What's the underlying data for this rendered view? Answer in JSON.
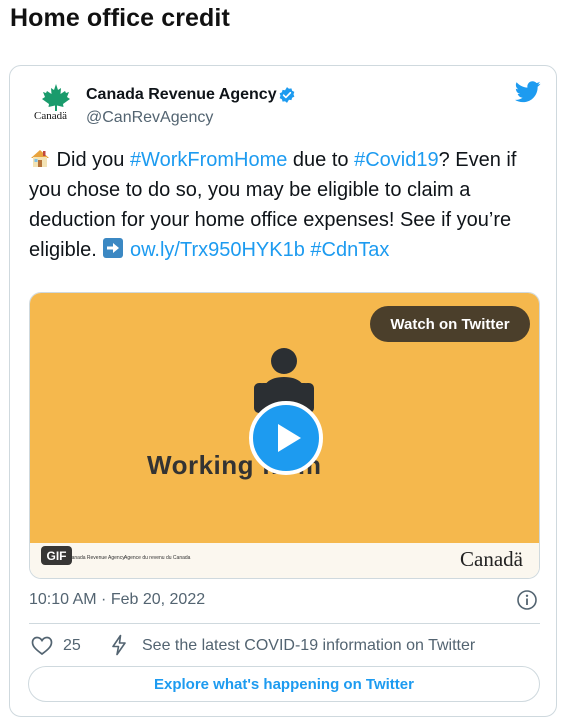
{
  "page": {
    "title": "Home office credit"
  },
  "tweet": {
    "author_name": "Canada Revenue Agency",
    "author_handle": "@CanRevAgency",
    "logo_word": "Canadä",
    "verified": true,
    "text_segments": [
      {
        "text": " Did you ",
        "type": "text"
      },
      {
        "text": "#WorkFromHome",
        "type": "hashtag"
      },
      {
        "text": " due to ",
        "type": "text"
      },
      {
        "text": "#Covid19",
        "type": "hashtag"
      },
      {
        "text": "? Even if you chose to do so, you may be eligible to claim a deduction for your home office expenses! See if you’re eligible. ",
        "type": "text"
      },
      {
        "text": " ",
        "type": "text"
      },
      {
        "text": "ow.ly/Trx950HYK1b",
        "type": "link"
      },
      {
        "text": " ",
        "type": "text"
      },
      {
        "text": "#CdnTax",
        "type": "hashtag"
      }
    ],
    "timestamp": "10:10 AM · Feb 20, 2022",
    "like_count": "25",
    "covid_link_text": "See the latest COVID-19 information on Twitter",
    "explore_label": "Explore what's happening on Twitter"
  },
  "media": {
    "type": "GIF",
    "gif_label": "GIF",
    "watch_label": "Watch on Twitter",
    "video_caption": "Working from",
    "footer_left": "Canada Revenue Agency",
    "footer_right": "Agence du revenu du Canada",
    "footer_wordmark": "Canadä"
  },
  "colors": {
    "accent": "#1d9bf0",
    "media_bg": "#f5b84d",
    "text": "#0f1419",
    "muted": "#536471"
  },
  "icons": [
    "maple-leaf-icon",
    "verified-badge-icon",
    "twitter-bird-icon",
    "house-emoji-icon",
    "right-arrow-emoji-icon",
    "play-icon",
    "info-icon",
    "heart-icon",
    "lightning-icon"
  ]
}
